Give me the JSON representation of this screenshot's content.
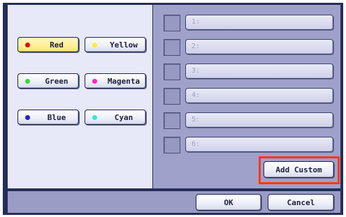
{
  "colors": {
    "accent_highlight": "#ff3a12",
    "selected_button": "#fff09a",
    "panel_dark": "#262d57"
  },
  "color_buttons": [
    {
      "label": "Red",
      "dot": "#e01010",
      "selected": true
    },
    {
      "label": "Yellow",
      "dot": "#ffee33",
      "selected": false
    },
    {
      "label": "Green",
      "dot": "#33dd33",
      "selected": false
    },
    {
      "label": "Magenta",
      "dot": "#ff22cc",
      "selected": false
    },
    {
      "label": "Blue",
      "dot": "#1a26c9",
      "selected": false
    },
    {
      "label": "Cyan",
      "dot": "#33e5e5",
      "selected": false
    }
  ],
  "custom_slots": [
    "1:",
    "2:",
    "3:",
    "4:",
    "5:",
    "6:"
  ],
  "add_custom_label": "Add Custom",
  "ok_label": "OK",
  "cancel_label": "Cancel"
}
